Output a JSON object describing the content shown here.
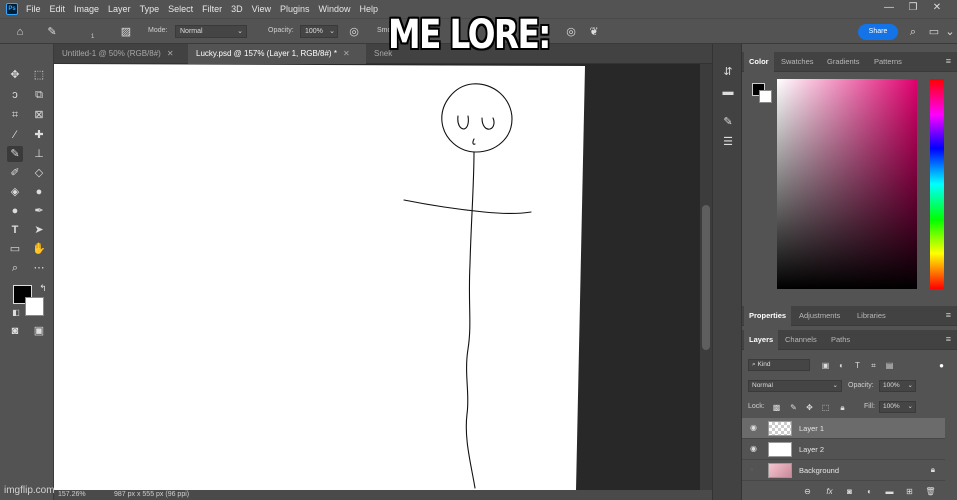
{
  "caption": "ME LORE:",
  "app": {
    "logo": "Ps"
  },
  "menu": [
    "File",
    "Edit",
    "Image",
    "Layer",
    "Type",
    "Select",
    "Filter",
    "3D",
    "View",
    "Plugins",
    "Window",
    "Help"
  ],
  "window_controls": {
    "minimize": "—",
    "restore": "❐",
    "close": "✕"
  },
  "options_bar": {
    "brush_size": "1",
    "mode_label": "Mode:",
    "mode_value": "Normal",
    "opacity_label": "Opacity:",
    "opacity_value": "100%",
    "smoothing_label": "Smo",
    "share_label": "Share"
  },
  "doc_tabs": [
    {
      "label": "Untitled-1 @ 50% (RGB/8#)",
      "active": false
    },
    {
      "label": "Lucky.psd @ 157% (Layer 1, RGB/8#) *",
      "active": true
    },
    {
      "label": "Snek",
      "active": false
    }
  ],
  "status": {
    "zoom": "157.26%",
    "doc_size": "987 px x 555 px (96 ppi)"
  },
  "color_panel": {
    "tabs": [
      "Color",
      "Swatches",
      "Gradients",
      "Patterns"
    ],
    "active": "Color"
  },
  "properties_panel": {
    "tabs": [
      "Properties",
      "Adjustments",
      "Libraries"
    ],
    "active": "Properties"
  },
  "layers_panel": {
    "tabs": [
      "Layers",
      "Channels",
      "Paths"
    ],
    "active": "Layers",
    "filter_kind": "Kind",
    "blend_mode": "Normal",
    "opacity_label": "Opacity:",
    "opacity_value": "100%",
    "lock_label": "Lock:",
    "fill_label": "Fill:",
    "fill_value": "100%",
    "layers": [
      {
        "name": "Layer 1",
        "selected": true,
        "visible": true,
        "thumb": "transparent",
        "locked": false
      },
      {
        "name": "Layer 2",
        "selected": false,
        "visible": true,
        "thumb": "white",
        "locked": false
      },
      {
        "name": "Background",
        "selected": false,
        "visible": false,
        "thumb": "image",
        "locked": true
      }
    ]
  },
  "watermark": "imgflip.com",
  "colors": {
    "foreground": "#000000",
    "background": "#ffffff",
    "accent": "#1473e6"
  },
  "icons": {
    "home": "home-icon",
    "brush": "brush-icon",
    "move": "move-icon",
    "lasso": "lasso-icon",
    "crop": "crop-icon",
    "eyedropper": "eyedropper-icon",
    "pencil": "pencil-icon",
    "type": "type-icon",
    "hand": "hand-icon",
    "zoom": "zoom-icon",
    "search": "search-icon",
    "eye": "eye-icon",
    "lock": "lock-icon",
    "trash": "trash-icon"
  }
}
